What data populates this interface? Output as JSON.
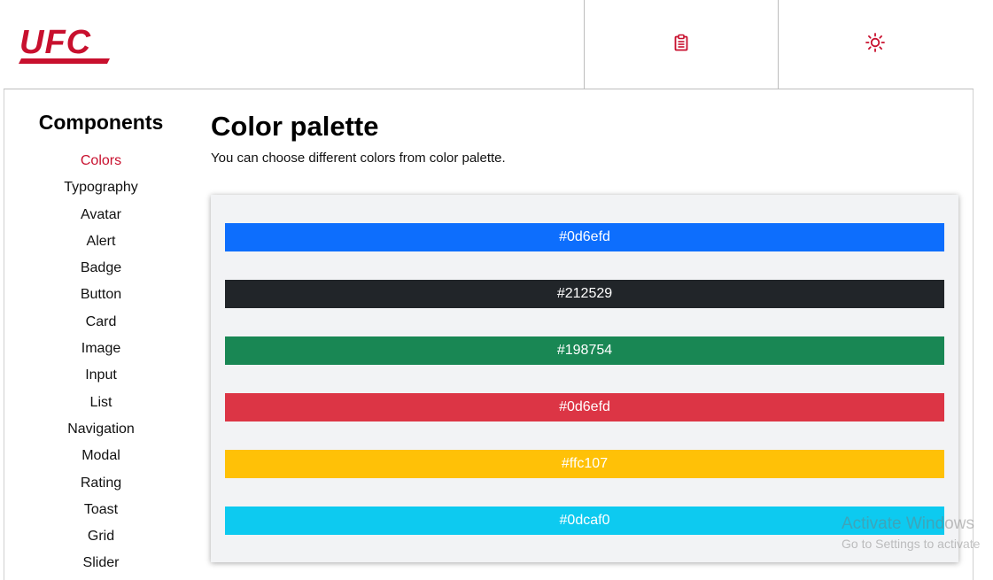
{
  "header": {
    "logo_text": "UFC",
    "buttons": [
      {
        "icon": "clipboard-icon"
      },
      {
        "icon": "sun-icon"
      }
    ]
  },
  "sidebar": {
    "title": "Components",
    "items": [
      "Colors",
      "Typography",
      "Avatar",
      "Alert",
      "Badge",
      "Button",
      "Card",
      "Image",
      "Input",
      "List",
      "Navigation",
      "Modal",
      "Rating",
      "Toast",
      "Grid",
      "Slider"
    ],
    "active_index": 0
  },
  "main": {
    "title": "Color palette",
    "description": "You can choose different colors from color palette."
  },
  "palette": [
    {
      "label": "#0d6efd",
      "color": "#0d6efd"
    },
    {
      "label": "#212529",
      "color": "#212529"
    },
    {
      "label": "#198754",
      "color": "#198754"
    },
    {
      "label": "#0d6efd",
      "color": "#dc3545"
    },
    {
      "label": "#ffc107",
      "color": "#ffc107"
    },
    {
      "label": "#0dcaf0",
      "color": "#0dcaf0"
    }
  ],
  "colors": {
    "brand": "#c8102e",
    "palette_bg": "#f2f3f5"
  },
  "watermark": {
    "line1": "Activate Windows",
    "line2": "Go to Settings to activate"
  }
}
